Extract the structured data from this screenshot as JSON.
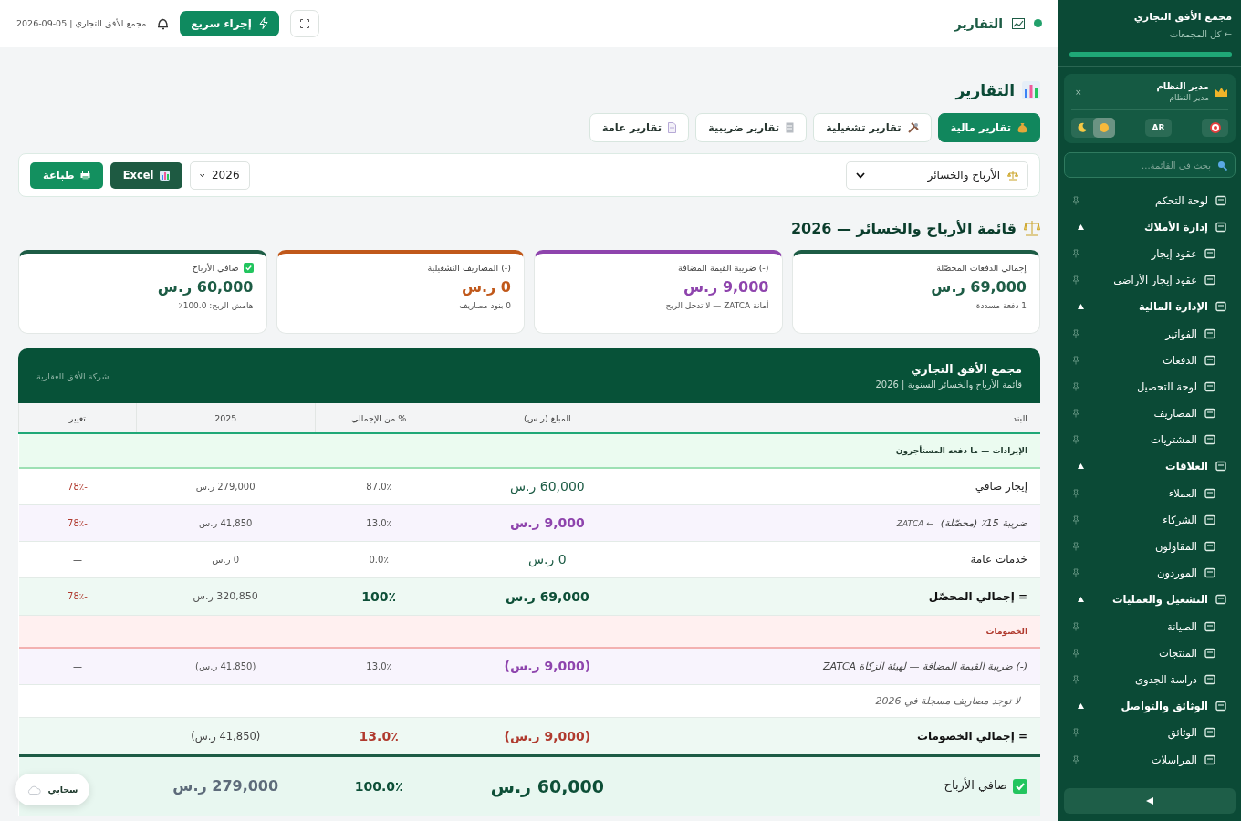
{
  "sidebar": {
    "title": "مجمع الأفق التجاري",
    "back_link": "← كل المجمعات",
    "user": {
      "name": "مدير النظام",
      "role": "مدير النظام",
      "close": "×"
    },
    "theme_modes": [
      {
        "kind": "light",
        "selected": true
      },
      {
        "kind": "dark",
        "selected": false
      }
    ],
    "language": "AR",
    "search": {
      "placeholder": "بحث في القائمة..."
    },
    "nav": [
      {
        "label": "لوحة التحكم"
      },
      {
        "label": "إدارة الأملاك",
        "expanded": true,
        "children": [
          {
            "label": "عقود إيجار"
          },
          {
            "label": "عقود إيجار الأراضي"
          }
        ]
      },
      {
        "label": "الإدارة المالية",
        "expanded": true,
        "children": [
          {
            "label": "الفواتير"
          },
          {
            "label": "الدفعات"
          },
          {
            "label": "لوحة التحصيل"
          },
          {
            "label": "المصاريف"
          },
          {
            "label": "المشتريات"
          }
        ]
      },
      {
        "label": "العلاقات",
        "expanded": true,
        "children": [
          {
            "label": "العملاء"
          },
          {
            "label": "الشركاء"
          },
          {
            "label": "المقاولون"
          },
          {
            "label": "الموردون"
          }
        ]
      },
      {
        "label": "التشغيل والعمليات",
        "expanded": true,
        "children": [
          {
            "label": "الصيانة"
          },
          {
            "label": "المنتجات"
          },
          {
            "label": "دراسة الجدوى"
          }
        ]
      },
      {
        "label": "الوثائق والتواصل",
        "expanded": true,
        "children": [
          {
            "label": "الوثائق"
          },
          {
            "label": "المراسلات"
          }
        ]
      }
    ]
  },
  "topbar": {
    "title": "التقارير",
    "context": "2026-09-05 | مجمع الأفق التجاري",
    "quick_action": "إجراء سريع"
  },
  "page_title": "التقارير",
  "tabs": [
    {
      "label": "تقارير مالية",
      "selected": true
    },
    {
      "label": "تقارير تشغيلية",
      "selected": false
    },
    {
      "label": "تقارير ضريبية",
      "selected": false
    },
    {
      "label": "تقارير عامة",
      "selected": false
    }
  ],
  "filters": {
    "report": "الأرباح والخسائر",
    "year": "2026",
    "excel": "Excel",
    "print": "طباعة"
  },
  "section_title": "قائمة الأرباح والخسائر — 2026",
  "cards": [
    {
      "label": "إجمالي الدفعات المحصّلة",
      "value": "69,000 ر.س",
      "note": "1 دفعة مسددة",
      "color": "#1d5c45"
    },
    {
      "label": "(-) ضريبة القيمة المضافة",
      "value": "9,000 ر.س",
      "note": "أمانة ZATCA — لا تدخل الربح",
      "color": "#8e44ad"
    },
    {
      "label": "(-) المصاريف التشغيلية",
      "value": "0 ر.س",
      "note": "0 بنود مصاريف",
      "color": "#c0581a"
    },
    {
      "label": "صافي الأرباح",
      "value": "60,000 ر.س",
      "note": "هامش الربح: 100.0٪",
      "color": "#1d5c45",
      "checked": true
    }
  ],
  "statement": {
    "title": "مجمع الأفق التجاري",
    "subtitle": "قائمة الأرباح والخسائر السنوية | 2026",
    "company": "شركة الأفق العقارية",
    "columns": [
      "البند",
      "المبلغ (ر.س)",
      "% من الإجمالي",
      "2025",
      "تغيير"
    ],
    "rows": [
      {
        "kind": "income-section",
        "item": "الإيرادات — ما دفعه المستأجرون"
      },
      {
        "kind": "line",
        "item": "إيجار صافي",
        "amount": "60,000 ر.س",
        "percent": "87.0٪",
        "prev": "279,000 ر.س",
        "change": "-78٪",
        "change_negative": true
      },
      {
        "kind": "tax-line",
        "item": "ضريبة 15٪ (محصّلة)",
        "tag": "← ZATCA",
        "amount": "9,000 ر.س",
        "percent": "13.0٪",
        "prev": "41,850 ر.س",
        "change": "-78٪",
        "change_negative": true
      },
      {
        "kind": "line",
        "item": "خدمات عامة",
        "amount": "0 ر.س",
        "percent": "0.0٪",
        "prev": "0 ر.س",
        "change": "—",
        "change_negative": false
      },
      {
        "kind": "total",
        "item": "= إجمالي المحصّل",
        "amount": "69,000 ر.س",
        "percent": "100٪",
        "prev": "320,850 ر.س",
        "change": "-78٪",
        "change_negative": true
      },
      {
        "kind": "deduction-section",
        "item": "الخصومات"
      },
      {
        "kind": "tax-line",
        "item": "(-) ضريبة القيمة المضافة — لهيئة الزكاة ZATCA",
        "amount": "(9,000 ر.س)",
        "percent": "13.0٪",
        "prev": "(41,850 ر.س)",
        "change": "—",
        "change_negative": false
      },
      {
        "kind": "note",
        "item": "لا توجد مصاريف مسجلة في 2026"
      },
      {
        "kind": "deduction-total",
        "item": "= إجمالي الخصومات",
        "amount": "(9,000 ر.س)",
        "percent": "13.0٪",
        "prev": "(41,850 ر.س)"
      },
      {
        "kind": "net",
        "item": "صافي الأرباح",
        "amount": "60,000 ر.س",
        "percent": "100.0٪",
        "prev": "279,000 ر.س"
      }
    ]
  },
  "storage_chip": {
    "label": "سحابي"
  }
}
